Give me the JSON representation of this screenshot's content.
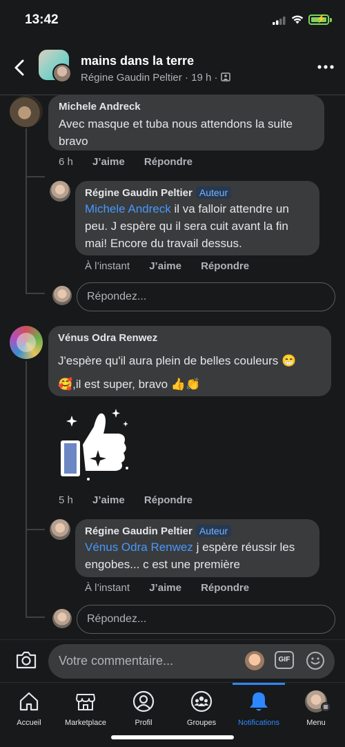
{
  "status_bar": {
    "time": "13:42"
  },
  "header": {
    "title": "mains dans la terre",
    "author": "Régine Gaudin Peltier",
    "age": "19 h"
  },
  "comments": [
    {
      "author": "Michele Andreck",
      "text_line1": "Avec masque et tuba nous attendons la suite",
      "text_line2": "bravo",
      "time": "6 h",
      "like_label": "J’aime",
      "reply_label": "Répondre",
      "reply": {
        "author": "Régine Gaudin Peltier",
        "badge": "Auteur",
        "mention": "Michele Andreck",
        "text_line1": " il va falloir attendre un",
        "text_line2": "peu. J espère qu il sera cuit avant la fin",
        "text_line3": "mai! Encore du travail dessus.",
        "time": "À l’instant",
        "like_label": "J’aime",
        "reply_label": "Répondre"
      },
      "reply_placeholder": "Répondez..."
    },
    {
      "author": "Vénus Odra Renwez",
      "text_line1": "J'espère qu'il aura plein de belles couleurs 😁",
      "text_line2": "🥰,il est super, bravo 👍👏",
      "time": "5 h",
      "like_label": "J’aime",
      "reply_label": "Répondre",
      "reply": {
        "author": "Régine Gaudin Peltier",
        "badge": "Auteur",
        "mention": "Vénus Odra Renwez",
        "text_line1": " j espère réussir les",
        "text_line2": "engobes... c est une première",
        "time": "À l’instant",
        "like_label": "J’aime",
        "reply_label": "Répondre"
      },
      "reply_placeholder": "Répondez..."
    }
  ],
  "composer": {
    "placeholder": "Votre commentaire...",
    "gif_label": "GIF"
  },
  "tabs": [
    {
      "label": "Accueil",
      "icon": "home-icon"
    },
    {
      "label": "Marketplace",
      "icon": "marketplace-icon"
    },
    {
      "label": "Profil",
      "icon": "profile-icon"
    },
    {
      "label": "Groupes",
      "icon": "groups-icon"
    },
    {
      "label": "Notifications",
      "icon": "bell-icon",
      "active": true
    },
    {
      "label": "Menu",
      "icon": "menu-avatar-icon"
    }
  ],
  "colors": {
    "accent": "#2d88ff",
    "mention": "#4599ff",
    "bubble": "#3a3b3c",
    "background": "#18191a"
  }
}
